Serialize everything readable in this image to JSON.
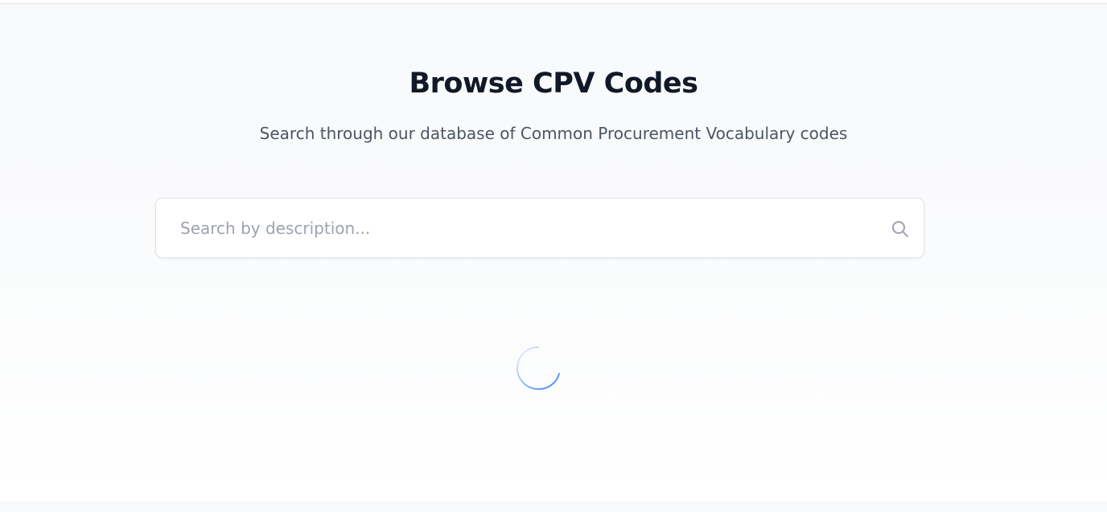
{
  "page": {
    "title": "Browse CPV Codes",
    "subtitle": "Search through our database of Common Procurement Vocabulary codes"
  },
  "search": {
    "placeholder": "Search by description...",
    "value": "",
    "icon": "search-icon"
  },
  "loading": {
    "icon": "loading-spinner"
  },
  "colors": {
    "title": "#111827",
    "subtitle": "#4b5563",
    "placeholder": "#9ca3af",
    "spinner": "#3b82f6",
    "background": "#f8f9fb"
  }
}
